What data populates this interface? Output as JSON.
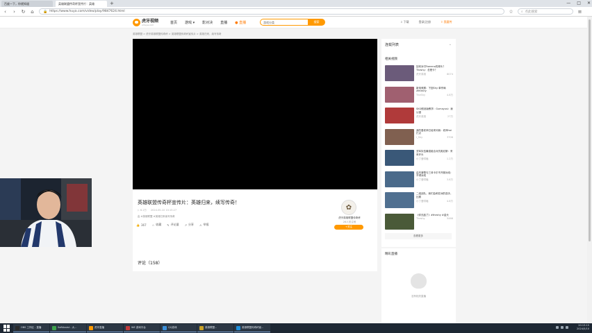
{
  "browser": {
    "tabs": [
      {
        "label": "百度一下，你就知道",
        "active": false
      },
      {
        "label": "英雄联盟传奇杯宣传片：英雄",
        "active": true
      }
    ],
    "url": "https://www.huya.com/video/play/9847624.html",
    "url_secure_label": "",
    "search_placeholder": "点此搜索",
    "window_controls": [
      "—",
      "□",
      "✕"
    ]
  },
  "site": {
    "logo_name": "虎牙视频",
    "logo_domain": "v.huya.com",
    "nav": [
      "首页",
      "游戏",
      "影对决",
      "直播"
    ],
    "nav_dropdown_marker": "▾",
    "live_label": "直播",
    "search_placeholder": "游戏分类",
    "search_button": "搜索",
    "download_label": "下载",
    "login_label": "登录|注册",
    "upload_label": "我要传",
    "breadcrumb": "英雄联盟 > 虎牙英雄联盟传奇杯 > 英雄联盟传奇杯宣传片 > 英雄归来，续写传奇"
  },
  "video": {
    "title": "英雄联盟传奇杯宣传片：英雄归来，续写传奇！",
    "views": "6.1万",
    "date": "2024-05-10 10:15:27",
    "tag": "由 #英雄联盟 #英雄归来续写传奇",
    "actions": [
      {
        "icon": "like-icon",
        "label": "367"
      },
      {
        "icon": "collect-icon",
        "label": "收藏"
      },
      {
        "icon": "comment-icon",
        "label": "评论量"
      },
      {
        "icon": "share-icon",
        "label": "分享"
      },
      {
        "icon": "report-icon",
        "label": "举报"
      }
    ],
    "uploader_name": "虎牙英雄联盟传奇杯",
    "uploader_fans": "26人关注他",
    "follow_label": "+关注",
    "comments_label": "评论（158）"
  },
  "sidebar": {
    "playlist_title": "连载列表",
    "related_title": "相关视频",
    "related": [
      {
        "title": "如何对付Faereno的掉头？Theshy：总是卡？",
        "author": "虎牙英雄",
        "count": "8074",
        "color": "#6b5b7a"
      },
      {
        "title": "新电竞赛：下回Shy 单杀局 #theshy",
        "author": "TheShy",
        "count": "4.8万",
        "color": "#a06070"
      },
      {
        "title": "SKG假设版教学：Gumayusi：我认错",
        "author": "虎牙英雄",
        "count": "27万",
        "color": "#b03a3a"
      },
      {
        "title": "我的爱老师已经来问我：老师hai 打点",
        "author": "i_Shy",
        "count": "3706",
        "color": "#806050"
      },
      {
        "title": "亚军队伍最强组合对抗奥尼斯：来来开头",
        "author": "小丁爱唠嗑",
        "count": "1.2万",
        "color": "#3a5878"
      },
      {
        "title": "由刘清楚与三体卡尔不开服对线：不得对线",
        "author": "小丁爱唠嗑",
        "count": "3.8万",
        "color": "#4a6a8a"
      },
      {
        "title": "二组战队，我们会和亚洲的选手，比赛",
        "author": "小丁爱唠嗑",
        "count": "4.8万",
        "color": "#507090"
      },
      {
        "title": "《你无敌了》#theshy #金头",
        "author": "Theshy",
        "count": "5466",
        "color": "#4a5a38"
      }
    ],
    "more_label": "查看更多",
    "live_title": "精彩直播",
    "live_empty": "没有相关直播"
  },
  "taskbar": {
    "items": [
      {
        "label": "OBS 工作区 - 直播",
        "color": "#2a2a2a"
      },
      {
        "label": "SoftAssist - 大...",
        "color": "#3fa34d"
      },
      {
        "label": "虎牙直播",
        "color": "#ff9900"
      },
      {
        "label": "WE 游戏平台",
        "color": "#c23b3b"
      },
      {
        "label": "QQ游戏",
        "color": "#3b8fd9"
      },
      {
        "label": "英雄联盟...",
        "color": "#c9a227"
      },
      {
        "label": "英雄联盟传奇杯宣...",
        "color": "#1f8fdb"
      }
    ],
    "time": "20:13:15",
    "date": "2024/5/10"
  }
}
